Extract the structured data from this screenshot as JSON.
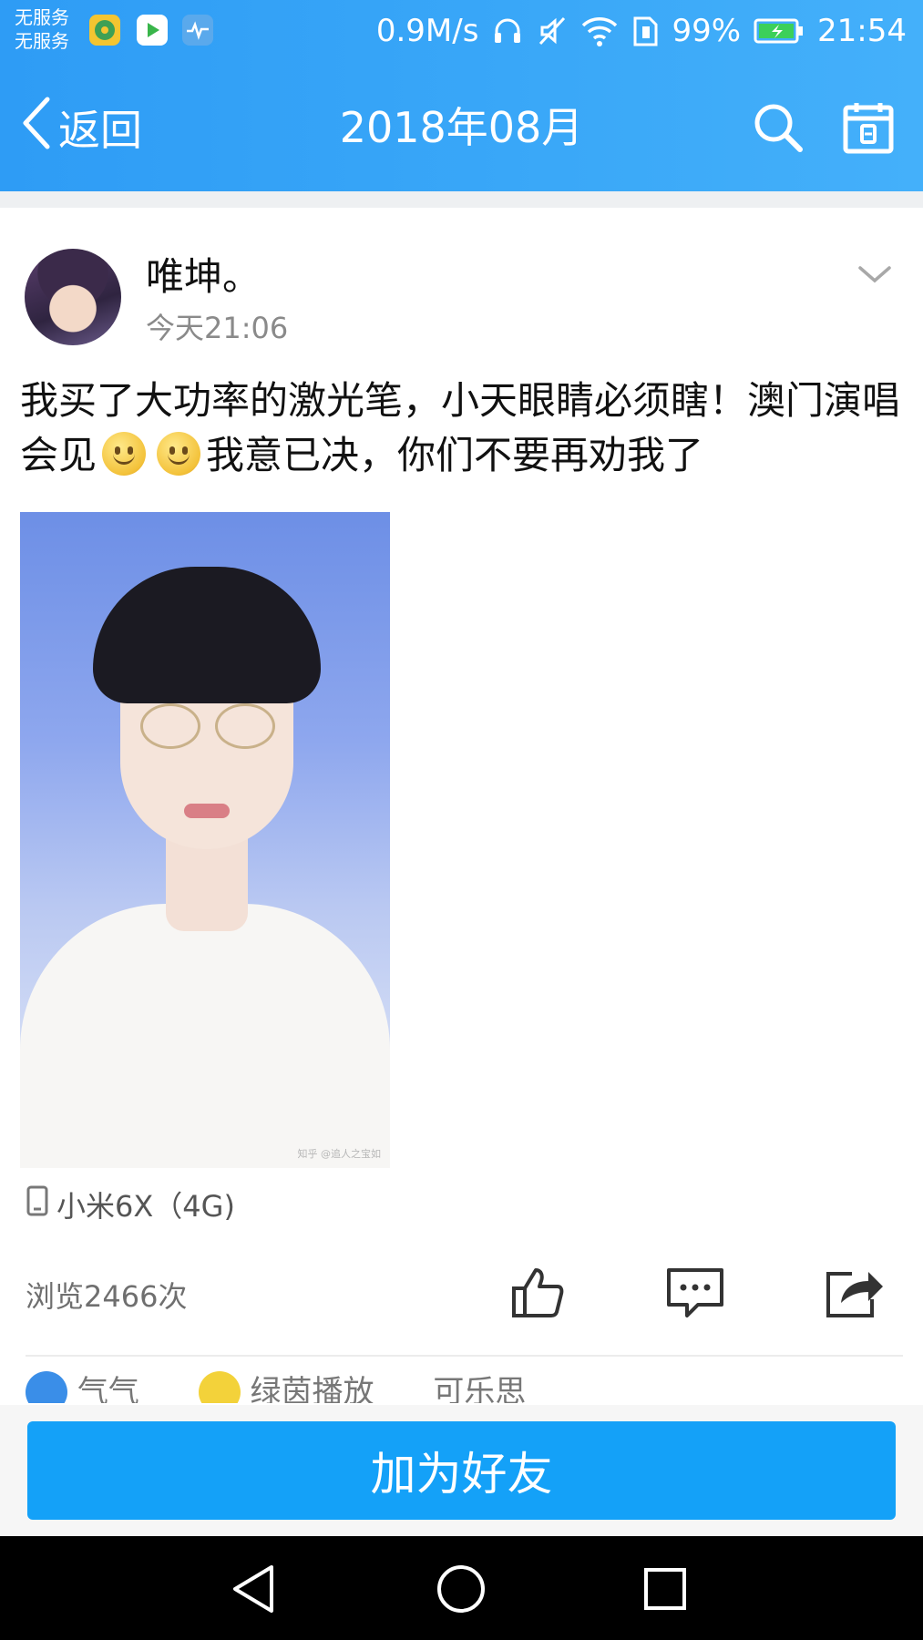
{
  "status_bar": {
    "carrier_line1": "无服务",
    "carrier_line2": "无服务",
    "net_speed": "0.9M/s",
    "battery_percent": "99%",
    "time": "21:54",
    "icons": [
      "music-app-icon",
      "video-app-icon",
      "health-app-icon",
      "headphones-icon",
      "mute-icon",
      "wifi-icon",
      "sim-icon",
      "battery-charging-icon"
    ]
  },
  "nav": {
    "back_label": "返回",
    "title": "2018年08月",
    "icons": [
      "back-chevron-icon",
      "search-icon",
      "calendar-icon"
    ]
  },
  "post": {
    "author": "唯坤。",
    "time": "今天21:06",
    "text_part1": "我买了大功率的激光笔，小天眼睛必须瞎！澳门演唱会见",
    "text_part2": "我意已决，你们不要再劝我了",
    "emoji_count": 2,
    "photo_watermark": "知乎 @追人之宝如",
    "device": "小米6X（4G)",
    "views": "浏览2466次"
  },
  "actions": {
    "icons": [
      "like-icon",
      "comment-icon",
      "share-icon"
    ]
  },
  "peek_row": {
    "text_a": "气气",
    "text_b": "绿茵播放",
    "text_c": "可乐思"
  },
  "bottom": {
    "add_friend_label": "加为好友"
  },
  "colors": {
    "header_blue": "#3aa8f8",
    "button_blue": "#14a1f8",
    "secondary_text": "#8a8a8a"
  }
}
